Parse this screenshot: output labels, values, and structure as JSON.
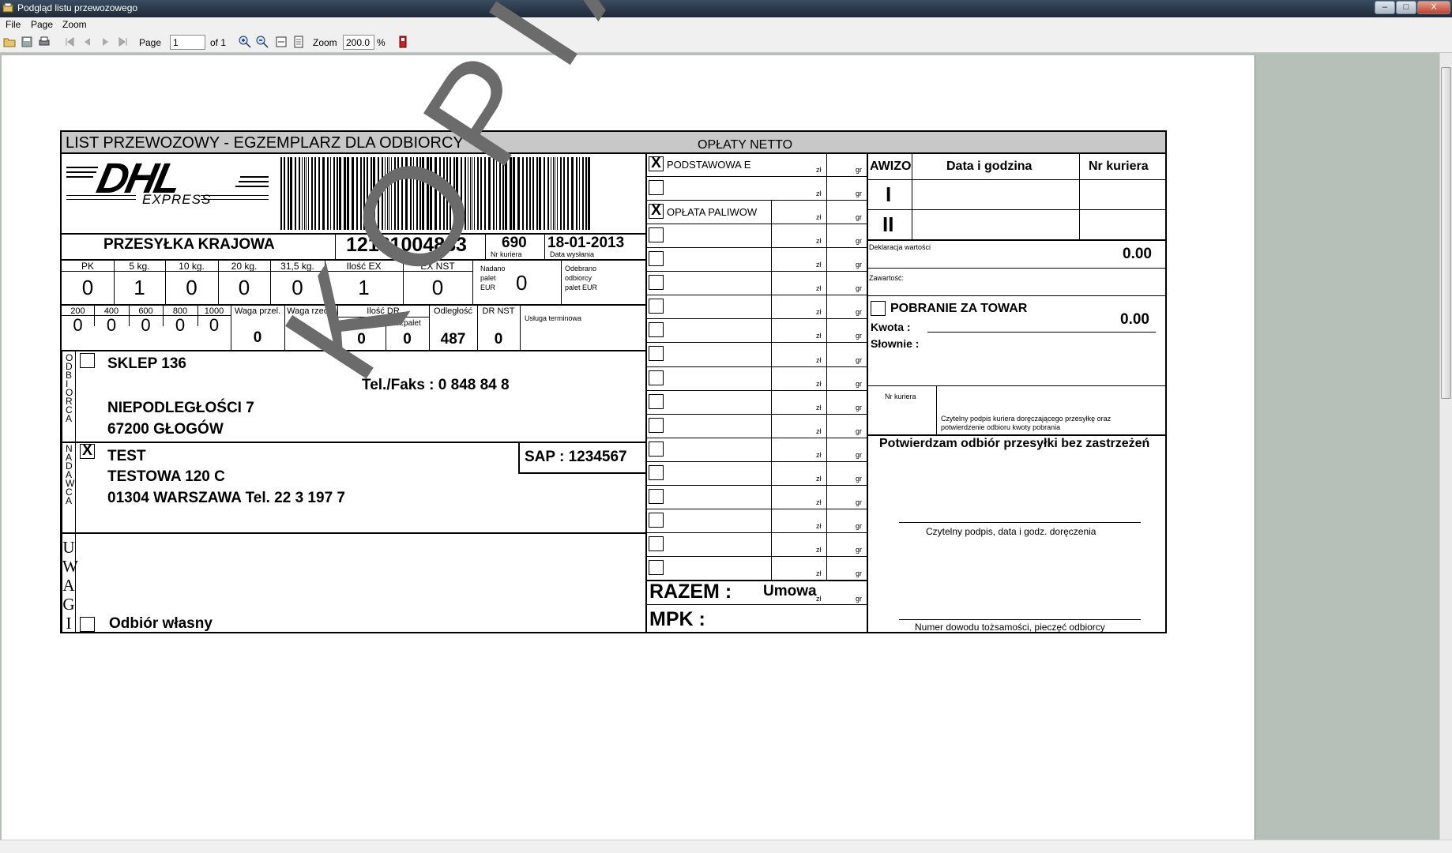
{
  "window": {
    "title": "Podgląd listu przewozowego",
    "controls": {
      "minimize": "–",
      "maximize": "□",
      "close": "X"
    }
  },
  "menu": [
    "File",
    "Page",
    "Zoom"
  ],
  "toolbar": {
    "page_label": "Page",
    "page_value": "1",
    "of_label": "of 1",
    "zoom_label": "Zoom",
    "zoom_value": "200.0",
    "percent": "%"
  },
  "waybill": {
    "header": "LIST PRZEWOZOWY - EGZEMPLARZ DLA ODBIORCY",
    "oplaty_header": "OPŁATY NETTO",
    "logo": {
      "brand": "DHL",
      "sub": "EXPRESS"
    },
    "przesylka": {
      "label": "PRZESYŁKA KRAJOWA",
      "number": "12131004883",
      "courier_no": "690",
      "courier_label": "Nr kuriera",
      "date": "18-01-2013",
      "date_label": "Data wysłania"
    },
    "weights": {
      "headers": [
        "PK",
        "5 kg.",
        "10 kg.",
        "20 kg.",
        "31,5 kg.",
        "Ilość EX",
        "EX NST"
      ],
      "values": [
        "0",
        "1",
        "0",
        "0",
        "0",
        "1",
        "0"
      ]
    },
    "nadano": {
      "label": [
        "Nadano",
        "palet",
        "EUR"
      ],
      "value": "0",
      "odebr_label": [
        "Odebrano",
        "odbiorcy",
        "palet EUR"
      ]
    },
    "row3": {
      "headers": [
        "200",
        "400",
        "600",
        "800",
        "1000"
      ],
      "values": [
        "0",
        "0",
        "0",
        "0",
        "0"
      ],
      "waga_przel": "Waga przel.",
      "waga_przel_val": "0",
      "waga_rzecz": "Waga rzecz.",
      "waga_rzecz_val": "0",
      "ilosc_dr": "Ilość DR",
      "razem": "Razem",
      "razem_val": "0",
      "wt_palet": "wt.palet",
      "wt_palet_val": "0",
      "odleglosc": "Odległość",
      "odleglosc_val": "487",
      "dr_nst": "DR NST",
      "dr_nst_val": "0",
      "usluga": "Usługa terminowa"
    },
    "odbiorca": {
      "side": "ODBIORCA",
      "name": "SKLEP 136",
      "tel": "Tel./Faks : 0 848 84 8",
      "street": "NIEPODLEGŁOŚCI 7",
      "city": "67200 GŁOGÓW"
    },
    "nadawca": {
      "side": "NADAWCA",
      "check": "X",
      "name": "TEST",
      "street": "TESTOWA 120 C",
      "city": "01304 WARSZAWA Tel. 22 3 197 7",
      "sap": "SAP : 1234567"
    },
    "uwagi": {
      "side": "UWAGI",
      "odbior": "Odbiór własny"
    },
    "charges": {
      "rows": [
        {
          "label": "PODSTAWOWA E",
          "check": "X"
        },
        {
          "label": "",
          "check": ""
        },
        {
          "label": "OPŁATA PALIWOW",
          "check": "X"
        },
        {
          "label": "",
          "check": ""
        },
        {
          "label": "",
          "check": ""
        },
        {
          "label": "",
          "check": ""
        },
        {
          "label": "",
          "check": ""
        },
        {
          "label": "",
          "check": ""
        },
        {
          "label": "",
          "check": ""
        },
        {
          "label": "",
          "check": ""
        },
        {
          "label": "",
          "check": ""
        },
        {
          "label": "",
          "check": ""
        },
        {
          "label": "",
          "check": ""
        },
        {
          "label": "",
          "check": ""
        },
        {
          "label": "",
          "check": ""
        },
        {
          "label": "",
          "check": ""
        },
        {
          "label": "",
          "check": ""
        },
        {
          "label": "",
          "check": ""
        }
      ],
      "zl": "zł",
      "gr": "gr",
      "razem": "RAZEM :",
      "umowa": "Umowa",
      "mpk": "MPK :"
    },
    "awizo": {
      "label": "AWIZO",
      "date_col": "Data i godzina",
      "courier_col": "Nr kuriera",
      "rows": [
        "I",
        "II"
      ]
    },
    "deklaracja": {
      "label": "Deklaracja wartości",
      "value": "0.00"
    },
    "zawartosc": {
      "label": "Zawartość:"
    },
    "pobranie": {
      "label": "POBRANIE ZA TOWAR",
      "value": "0.00",
      "kwota": "Kwota :",
      "slownie": "Słownie :"
    },
    "courier_sig": {
      "nr_label": "Nr kuriera",
      "text": "Czytelny podpis kuriera doręczającego przesyłkę oraz potwierdzenie odbioru kwoty pobrania"
    },
    "confirm": {
      "title": "Potwierdzam odbiór przesyłki bez zastrzeżeń",
      "sig1": "Czytelny podpis, data i godz. doręczenia",
      "sig2": "Numer dowodu tożsamości, pieczęć odbiorcy"
    },
    "watermark": "KOPIA"
  }
}
